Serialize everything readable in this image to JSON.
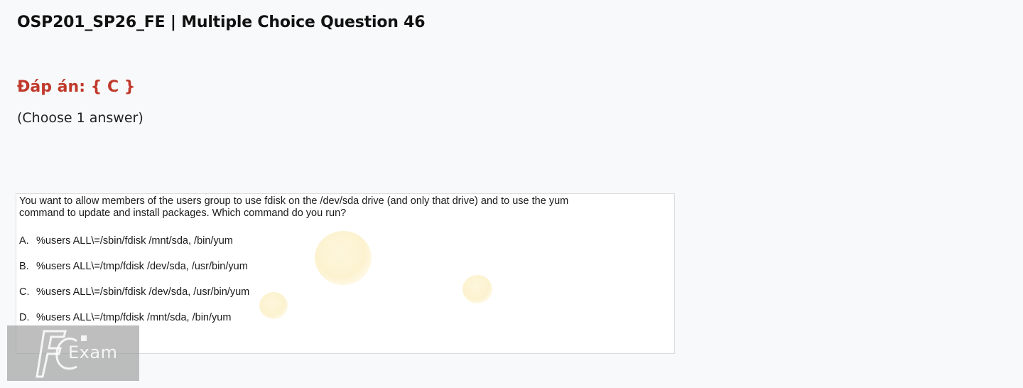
{
  "header": {
    "title": "OSP201_SP26_FE | Multiple Choice Question 46"
  },
  "answer": {
    "text": "Đáp án: { C }",
    "color": "#c0392b"
  },
  "instruction": "(Choose 1 answer)",
  "question": {
    "stem": "You want to allow members of the users group to use fdisk on the /dev/sda drive (and only that drive) and to use the yum command to update and install packages. Which command do you run?",
    "options": [
      {
        "letter": "A.",
        "text": "%users ALL\\=/sbin/fdisk /mnt/sda, /bin/yum"
      },
      {
        "letter": "B.",
        "text": "%users ALL\\=/tmp/fdisk /dev/sda, /usr/bin/yum"
      },
      {
        "letter": "C.",
        "text": "%users ALL\\=/sbin/fdisk /dev/sda, /usr/bin/yum"
      },
      {
        "letter": "D.",
        "text": "%users ALL\\=/tmp/fdisk /mnt/sda, /bin/yum"
      }
    ]
  },
  "watermark": {
    "logo": "fc-logo",
    "text": "Exam"
  }
}
